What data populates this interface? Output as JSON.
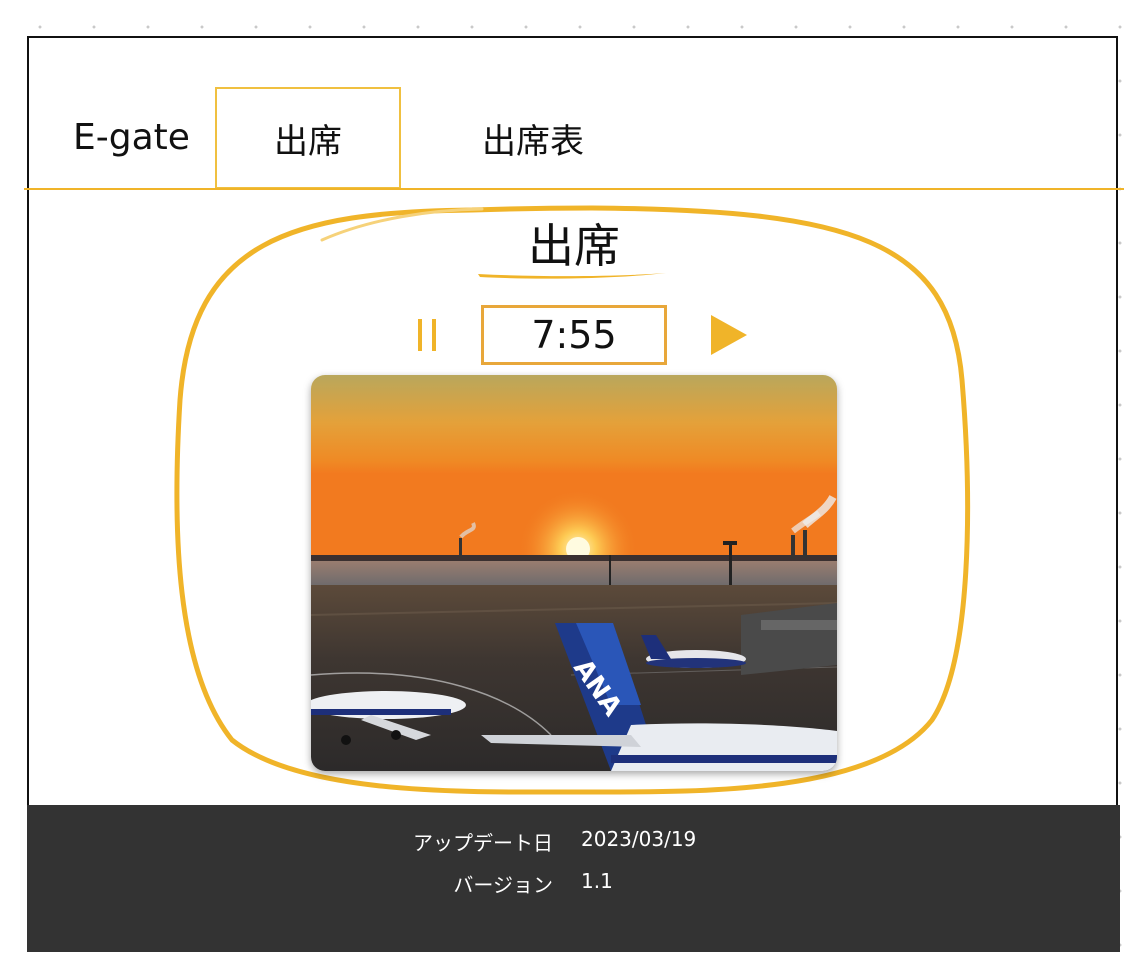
{
  "nav": {
    "brand": "E-gate",
    "tabs": [
      {
        "label": "出席",
        "active": true
      },
      {
        "label": "出席表",
        "active": false
      }
    ]
  },
  "main": {
    "title": "出席",
    "time_value": "7:55",
    "pause_icon": "pause-icon",
    "play_icon": "play-icon",
    "photo_text": "ANA"
  },
  "footer": {
    "update_label": "アップデート日",
    "update_value": "2023/03/19",
    "version_label": "バージョン",
    "version_value": "1.1"
  },
  "colors": {
    "accent": "#f0b429",
    "time_border": "#e8a73a",
    "footer_bg": "#333333"
  }
}
